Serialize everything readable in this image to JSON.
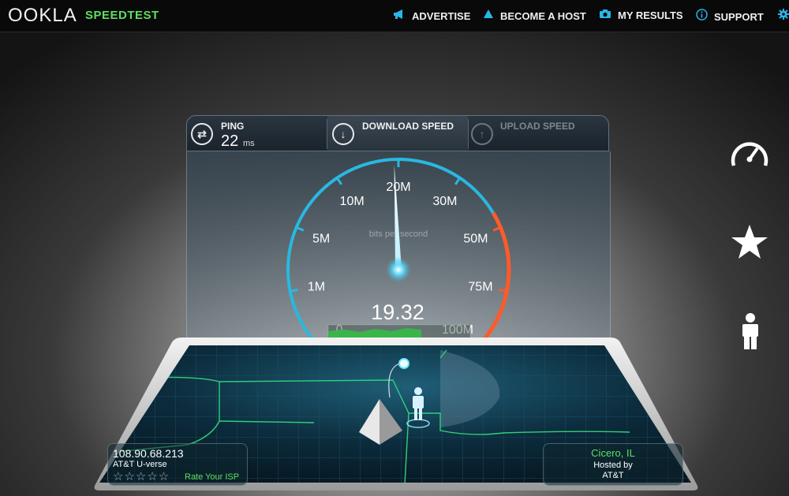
{
  "header": {
    "logo": "OOKLA",
    "product": "SPEEDTEST",
    "nav": [
      {
        "label": "ADVERTISE",
        "icon": "megaphone-icon"
      },
      {
        "label": "BECOME A HOST",
        "icon": "droplet-icon"
      },
      {
        "label": "MY RESULTS",
        "icon": "camera-icon"
      },
      {
        "label": "SUPPORT",
        "icon": "info-icon"
      }
    ],
    "settings_icon": "gear-icon"
  },
  "panel": {
    "ping": {
      "label": "PING",
      "value": "22",
      "unit": "ms"
    },
    "download": {
      "label": "DOWNLOAD SPEED"
    },
    "upload": {
      "label": "UPLOAD SPEED"
    }
  },
  "gauge": {
    "ticks": [
      "0",
      "1M",
      "5M",
      "10M",
      "20M",
      "30M",
      "50M",
      "75M",
      "100M"
    ],
    "subtitle": "bits per second",
    "value": "19.32",
    "needle_value_mbps": 19.32,
    "accent_color": "#29b8e0",
    "high_color": "#ff5a2a"
  },
  "server_info": {
    "ip": "108.90.68.213",
    "isp": "AT&T U-verse",
    "rating_stars": 5,
    "rate_label": "Rate Your ISP",
    "location": "Cicero, IL",
    "hosted_by_label": "Hosted by",
    "host": "AT&T"
  },
  "sidebar": [
    {
      "icon": "speedometer-icon"
    },
    {
      "icon": "star-icon"
    },
    {
      "icon": "person-icon"
    }
  ]
}
